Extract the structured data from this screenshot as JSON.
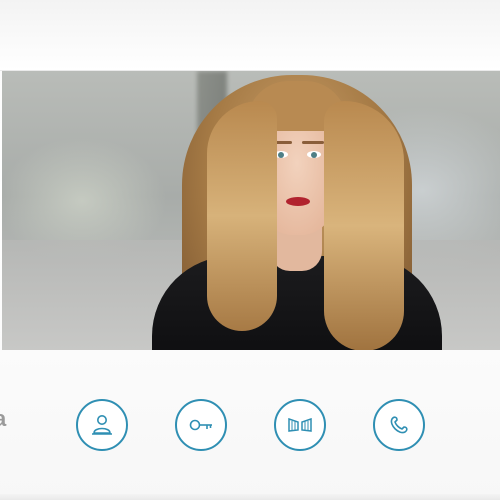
{
  "device": {
    "brand_fragment": "a",
    "accent_color": "#2f8fb3"
  },
  "screen": {
    "content": "camera-feed"
  },
  "controls": [
    {
      "icon": "person-monitor-icon"
    },
    {
      "icon": "key-icon"
    },
    {
      "icon": "gate-icon"
    },
    {
      "icon": "handset-icon"
    }
  ]
}
